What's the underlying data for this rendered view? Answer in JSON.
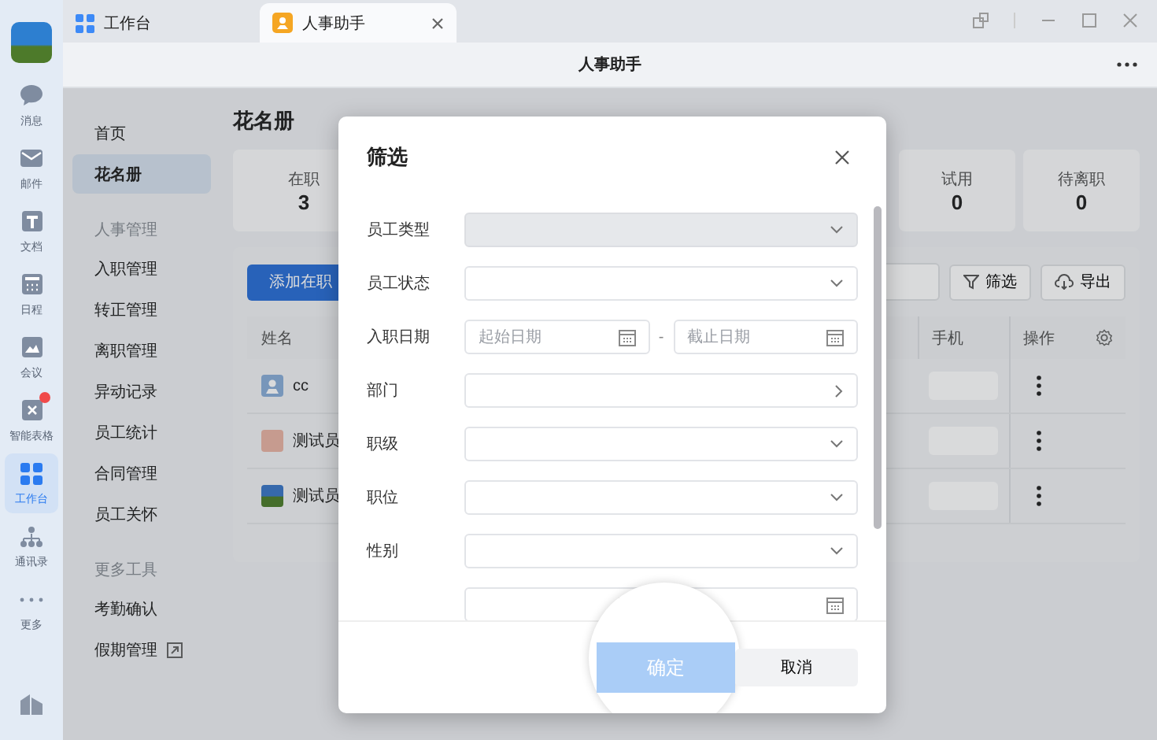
{
  "rail": {
    "items": [
      {
        "label": "消息",
        "selected": false,
        "badge": false
      },
      {
        "label": "邮件",
        "selected": false,
        "badge": false
      },
      {
        "label": "文档",
        "selected": false,
        "badge": false
      },
      {
        "label": "日程",
        "selected": false,
        "badge": false
      },
      {
        "label": "会议",
        "selected": false,
        "badge": false
      },
      {
        "label": "智能表格",
        "selected": false,
        "badge": true
      },
      {
        "label": "工作台",
        "selected": true,
        "badge": false
      },
      {
        "label": "通讯录",
        "selected": false,
        "badge": false
      },
      {
        "label": "更多",
        "selected": false,
        "badge": false
      }
    ]
  },
  "tabs": [
    {
      "label": "工作台",
      "selected": false,
      "closable": false
    },
    {
      "label": "人事助手",
      "selected": true,
      "closable": true
    }
  ],
  "header": {
    "title": "人事助手"
  },
  "nav": {
    "items": [
      {
        "kind": "link",
        "label": "首页",
        "selected": false,
        "external": false
      },
      {
        "kind": "link",
        "label": "花名册",
        "selected": true,
        "external": false
      },
      {
        "kind": "section",
        "label": "人事管理"
      },
      {
        "kind": "link",
        "label": "入职管理",
        "selected": false,
        "external": false
      },
      {
        "kind": "link",
        "label": "转正管理",
        "selected": false,
        "external": false
      },
      {
        "kind": "link",
        "label": "离职管理",
        "selected": false,
        "external": false
      },
      {
        "kind": "link",
        "label": "异动记录",
        "selected": false,
        "external": false
      },
      {
        "kind": "link",
        "label": "员工统计",
        "selected": false,
        "external": false
      },
      {
        "kind": "link",
        "label": "合同管理",
        "selected": false,
        "external": false
      },
      {
        "kind": "link",
        "label": "员工关怀",
        "selected": false,
        "external": false
      },
      {
        "kind": "section",
        "label": "更多工具"
      },
      {
        "kind": "link",
        "label": "考勤确认",
        "selected": false,
        "external": false
      },
      {
        "kind": "link",
        "label": "假期管理",
        "selected": false,
        "external": true
      }
    ]
  },
  "page": {
    "title": "花名册",
    "stats": [
      {
        "label": "在职",
        "value": "3"
      },
      {
        "label": "试用",
        "value": "0"
      },
      {
        "label": "待离职",
        "value": "0"
      }
    ],
    "toolbar": {
      "add_button": "添加在职",
      "filter_button": "筛选",
      "export_button": "导出"
    },
    "table": {
      "columns": [
        "姓名",
        "手机",
        "操作"
      ],
      "rows": [
        {
          "name": "cc"
        },
        {
          "name": "测试员"
        },
        {
          "name": "测试员"
        }
      ]
    }
  },
  "dialog": {
    "title": "筛选",
    "fields": [
      {
        "label": "员工类型",
        "kind": "select",
        "disabled": true
      },
      {
        "label": "员工状态",
        "kind": "select",
        "disabled": false
      },
      {
        "label": "入职日期",
        "kind": "date_range",
        "start_placeholder": "起始日期",
        "end_placeholder": "截止日期",
        "separator": "-"
      },
      {
        "label": "部门",
        "kind": "cascader",
        "disabled": false
      },
      {
        "label": "职级",
        "kind": "select",
        "disabled": false
      },
      {
        "label": "职位",
        "kind": "select",
        "disabled": false
      },
      {
        "label": "性别",
        "kind": "select",
        "disabled": false
      },
      {
        "kind": "date_range"
      }
    ],
    "confirm": {
      "label": "确定",
      "disabled": true
    },
    "cancel": "取消"
  }
}
